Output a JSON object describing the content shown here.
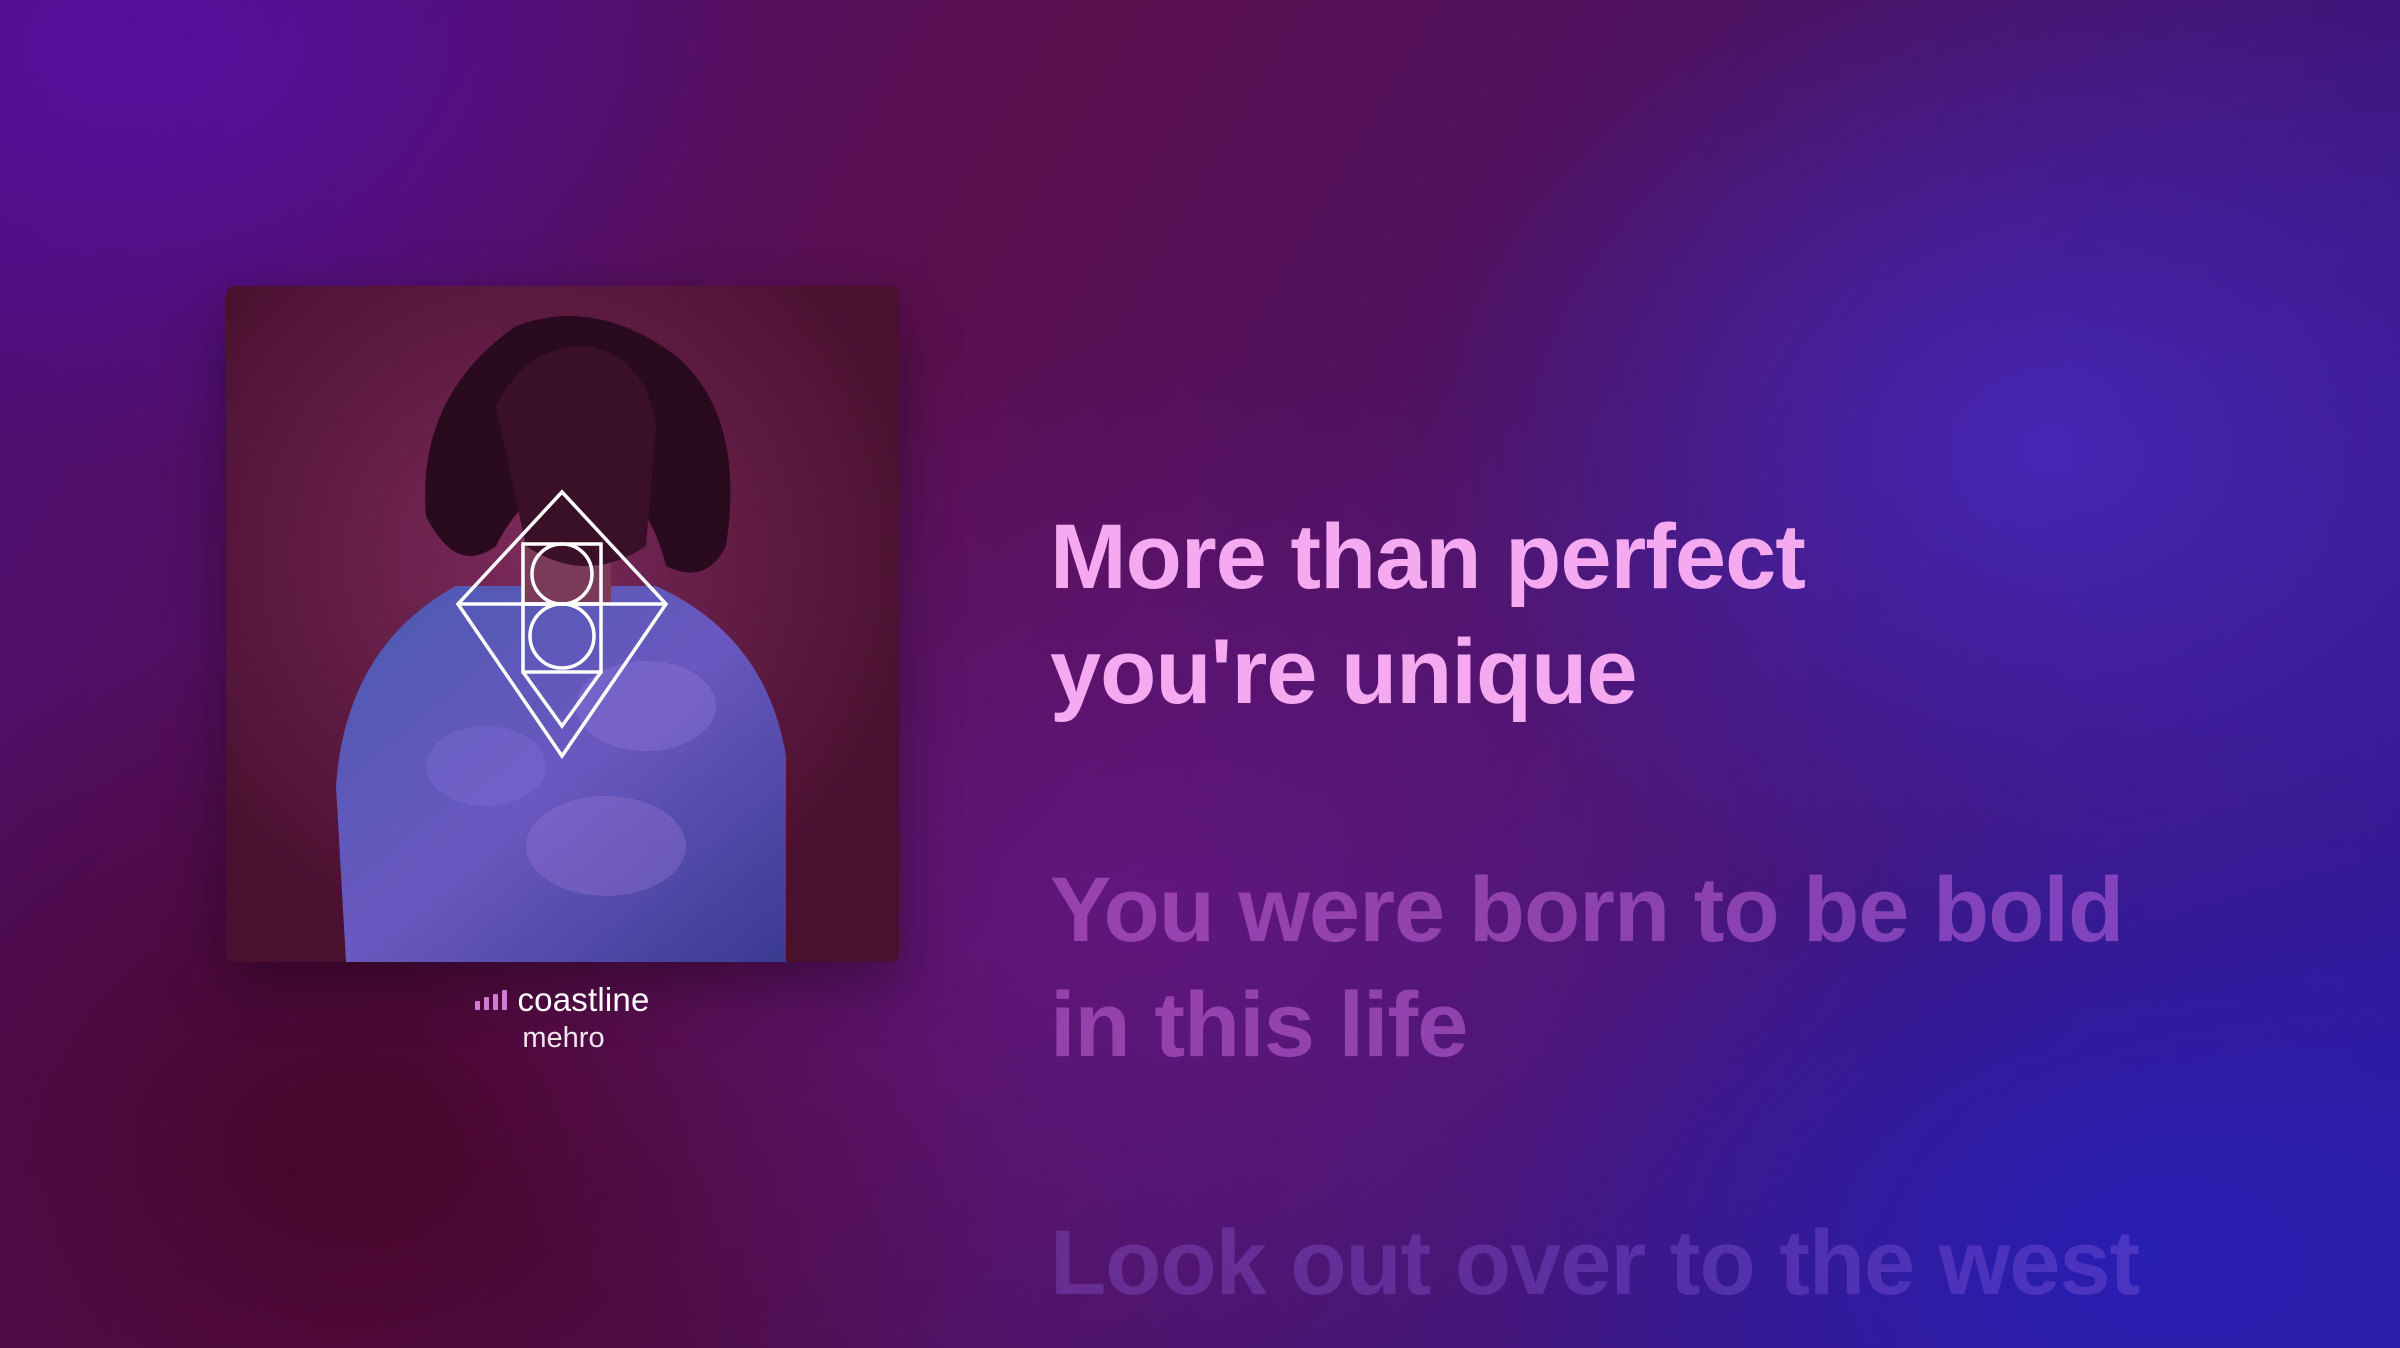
{
  "now_playing": {
    "title": "coastline",
    "artist": "mehro",
    "artwork_icon": "album-cover-diamond-emblem"
  },
  "lyrics": {
    "active": [
      "More than perfect",
      "you're unique"
    ],
    "next": [
      "You were born to be bold",
      "in this life"
    ],
    "later": [
      "Look out over to the west"
    ]
  },
  "colors": {
    "active_lyric": "#f5a9f0",
    "playing_indicator": "#d27ad6"
  }
}
